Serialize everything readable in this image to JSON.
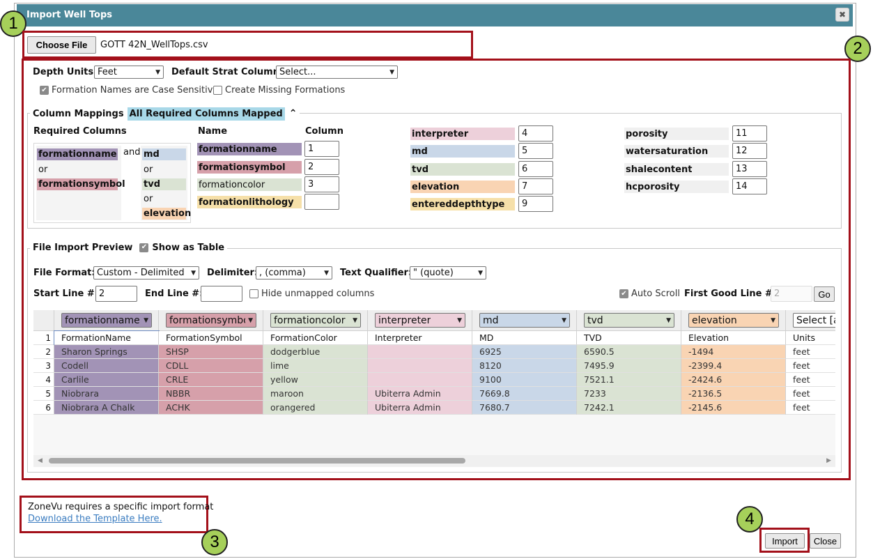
{
  "dialog": {
    "title": "Import Well Tops",
    "close_glyph": "✖"
  },
  "callouts": [
    "1",
    "2",
    "3",
    "4"
  ],
  "file": {
    "choose_label": "Choose File",
    "file_name": "GOTT 42N_WellTops.csv"
  },
  "options": {
    "depth_units_label": "Depth Units:",
    "depth_units_value": "Feet",
    "default_strat_label": "Default Strat Column:",
    "default_strat_value": "Select...",
    "case_sensitive_label": "Formation Names are Case Sensitive",
    "create_missing_label": "Create Missing Formations"
  },
  "mappings": {
    "legend_label": "Column Mappings",
    "status_badge": "All Required Columns Mapped",
    "required_label": "Required Columns",
    "req": {
      "formationname": "formationname",
      "or1": "or",
      "formationsymbol": "formationsymbol",
      "and": "and",
      "md": "md",
      "or2": "or",
      "tvd": "tvd",
      "or3": "or",
      "elevation": "elevation"
    },
    "name_header": "Name",
    "column_header": "Column",
    "col1": [
      {
        "name": "formationname",
        "value": "1"
      },
      {
        "name": "formationsymbol",
        "value": "2"
      },
      {
        "name": "formationcolor",
        "value": "3"
      },
      {
        "name": "formationlithology",
        "value": ""
      }
    ],
    "col2": [
      {
        "name": "interpreter",
        "value": "4"
      },
      {
        "name": "md",
        "value": "5"
      },
      {
        "name": "tvd",
        "value": "6"
      },
      {
        "name": "elevation",
        "value": "7"
      },
      {
        "name": "entereddepthtype",
        "value": "9"
      }
    ],
    "col3": [
      {
        "name": "porosity",
        "value": "11"
      },
      {
        "name": "watersaturation",
        "value": "12"
      },
      {
        "name": "shalecontent",
        "value": "13"
      },
      {
        "name": "hcporosity",
        "value": "14"
      }
    ]
  },
  "preview": {
    "legend_label": "File Import Preview",
    "show_table_label": "Show as Table",
    "file_format_label": "File Format:",
    "file_format_value": "Custom - Delimited",
    "delimiter_label": "Delimiter:",
    "delimiter_value": ", (comma)",
    "qualifier_label": "Text Qualifier:",
    "qualifier_value": "\" (quote)",
    "start_line_label": "Start Line #:",
    "start_line_value": "2",
    "end_line_label": "End Line #:",
    "end_line_value": "",
    "hide_unmapped_label": "Hide unmapped columns",
    "auto_scroll_label": "Auto Scroll",
    "first_good_label": "First Good Line #:",
    "first_good_value": "2",
    "go_label": "Go",
    "header_selects": [
      "formationname",
      "formationsymbol",
      "formationcolor",
      "interpreter",
      "md",
      "tvd",
      "elevation",
      "Select [a"
    ],
    "row_numbers": [
      "1",
      "2",
      "3",
      "4",
      "5",
      "6"
    ],
    "rows": [
      [
        "FormationName",
        "FormationSymbol",
        "FormationColor",
        "Interpreter",
        "MD",
        "TVD",
        "Elevation",
        "Units"
      ],
      [
        "Sharon Springs",
        "SHSP",
        "dodgerblue",
        "",
        "6925",
        "6590.5",
        "-1494",
        "feet"
      ],
      [
        "Codell",
        "CDLL",
        "lime",
        "",
        "8120",
        "7495.9",
        "-2399.4",
        "feet"
      ],
      [
        "Carlile",
        "CRLE",
        "yellow",
        "",
        "9100",
        "7521.1",
        "-2424.6",
        "feet"
      ],
      [
        "Niobrara",
        "NBBR",
        "maroon",
        "Ubiterra Admin",
        "7669.8",
        "7233",
        "-2136.5",
        "feet"
      ],
      [
        "Niobrara A Chalk",
        "ACHK",
        "orangered",
        "Ubiterra Admin",
        "7680.7",
        "7242.1",
        "-2145.6",
        "feet"
      ]
    ]
  },
  "footer": {
    "format_note": "ZoneVu requires a specific import format",
    "template_link": "Download the Template Here.",
    "import_label": "Import",
    "close_label": "Close"
  },
  "colors": {
    "titlebar": "#4a8799",
    "callout": "#a6d05a",
    "highlight_box": "#a3101a",
    "badge": "#a8d8e8"
  }
}
